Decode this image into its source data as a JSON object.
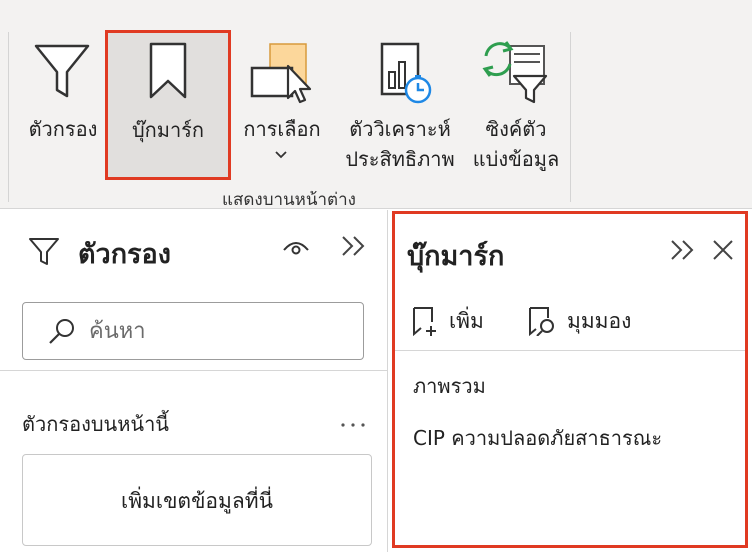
{
  "ribbon": {
    "buttons": [
      {
        "id": "filters",
        "label": "ตัวกรอง",
        "icon": "funnel-icon"
      },
      {
        "id": "bookmarks",
        "label": "บุ๊กมาร์ก",
        "icon": "bookmark-icon"
      },
      {
        "id": "selection",
        "label": "การเลือก",
        "icon": "selection-pane-icon"
      },
      {
        "id": "performance",
        "label1": "ตัววิเคราะห์",
        "label2": "ประสิทธิภาพ",
        "icon": "performance-analyzer-icon"
      },
      {
        "id": "sync",
        "label1": "ซิงค์ตัว",
        "label2": "แบ่งข้อมูล",
        "icon": "sync-slicers-icon"
      }
    ],
    "group_label": "แสดงบานหน้าต่าง"
  },
  "filters_pane": {
    "title": "ตัวกรอง",
    "search_placeholder": "ค้นหา",
    "section_label": "ตัวกรองบนหน้านี้",
    "add_fields": "เพิ่มเขตข้อมูลที่นี่"
  },
  "bookmarks_pane": {
    "title": "บุ๊กมาร์ก",
    "add_label": "เพิ่ม",
    "view_label": "มุมมอง",
    "items": [
      "ภาพรวม",
      "CIP ความปลอดภัยสาธารณะ"
    ]
  },
  "colors": {
    "highlight": "#e03a22",
    "ribbon_bg": "#f3f2f1",
    "selected_bg": "#e1dfdd",
    "accent_blue": "#1e88e5",
    "accent_green": "#2e9e4f"
  }
}
